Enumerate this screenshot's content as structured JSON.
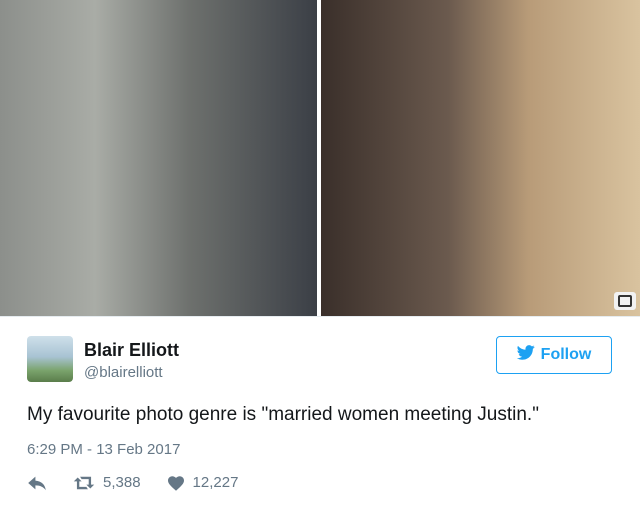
{
  "tweet": {
    "author_name": "Blair Elliott",
    "author_handle": "@blairelliott",
    "follow_label": "Follow",
    "text": "My favourite photo genre is \"married women meeting Justin.\"",
    "timestamp": "6:29 PM - 13 Feb 2017",
    "retweets": "5,388",
    "likes": "12,227"
  },
  "colors": {
    "brand_blue": "#1da1f2",
    "secondary_text": "#657786",
    "primary_text": "#14171a"
  },
  "icons": {
    "camera": "camera-icon",
    "bird": "twitter-bird-icon",
    "reply": "reply-icon",
    "retweet": "retweet-icon",
    "like": "heart-icon"
  }
}
